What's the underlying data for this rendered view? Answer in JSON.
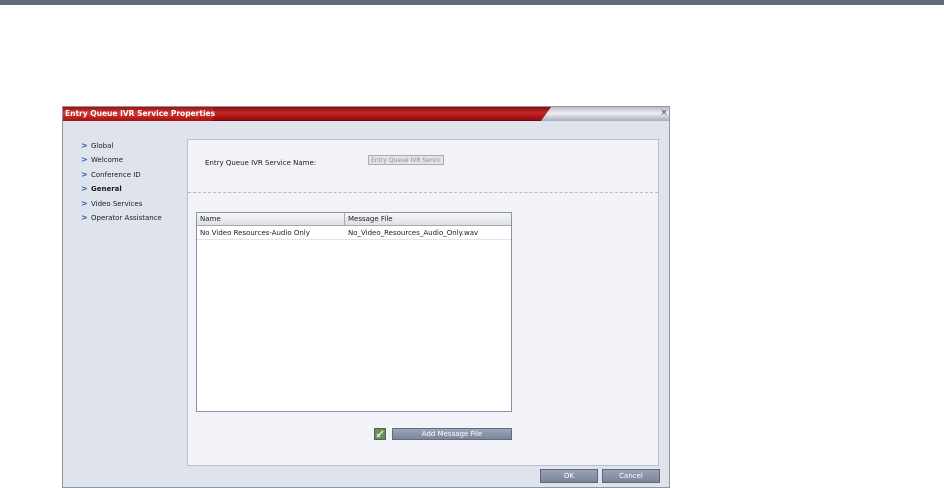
{
  "dialog": {
    "title": "Entry Queue IVR Service Properties",
    "close_label": "×"
  },
  "nav": {
    "items": [
      {
        "label": "Global",
        "active": false
      },
      {
        "label": "Welcome",
        "active": false
      },
      {
        "label": "Conference ID",
        "active": false
      },
      {
        "label": "General",
        "active": true
      },
      {
        "label": "Video Services",
        "active": false
      },
      {
        "label": "Operator Assistance",
        "active": false
      }
    ],
    "chevron": ">"
  },
  "general": {
    "service_name_label": "Entry Queue IVR Service Name:",
    "service_name_value": "Entry Queue IVR Servic"
  },
  "table": {
    "columns": [
      "Name",
      "Message File"
    ],
    "rows": [
      [
        "No Video Resources-Audio Only",
        "No_Video_Resources_Audio_Only.wav"
      ]
    ]
  },
  "buttons": {
    "add_message_file": "Add Message File",
    "ok": "OK",
    "cancel": "Cancel"
  },
  "colors": {
    "title_bar": "#b51f1f",
    "panel_bg": "#dfe3ec",
    "button": "#8791a5",
    "nav_chevron": "#2b5da8"
  }
}
